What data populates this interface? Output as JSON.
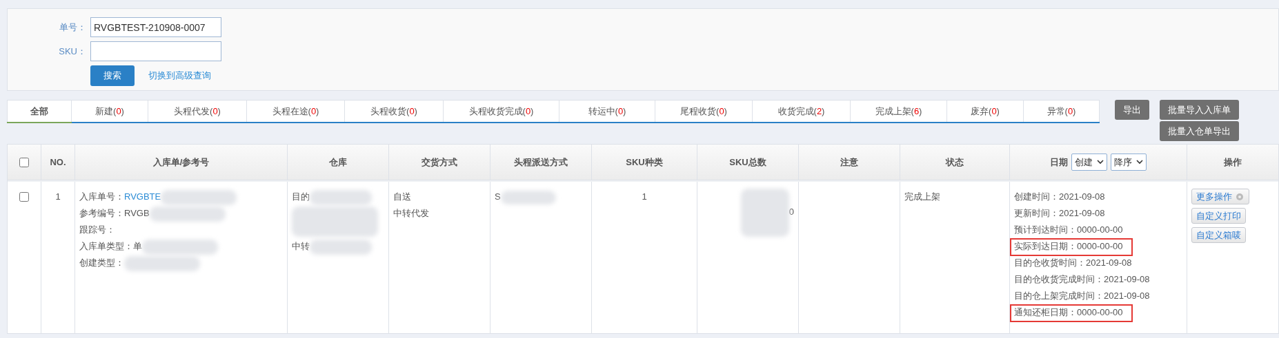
{
  "search": {
    "fields": [
      {
        "label": "单号：",
        "value": "RVGBTEST-210908-0007"
      },
      {
        "label": "SKU："
      }
    ],
    "button": "搜索",
    "link": "切换到高级查询"
  },
  "tabs": [
    {
      "label": "全部",
      "selected": true
    },
    {
      "label": "新建",
      "open": "(",
      "count": "0",
      "close": ")",
      "selected": false
    },
    {
      "label": "头程代发",
      "open": "(",
      "count": "0",
      "close": ")",
      "selected": false
    },
    {
      "label": "头程在途",
      "open": "(",
      "count": "0",
      "close": ")",
      "selected": false
    },
    {
      "label": "头程收货",
      "open": "(",
      "count": "0",
      "close": ")",
      "selected": false
    },
    {
      "label": "头程收货完成",
      "open": "(",
      "count": "0",
      "close": ")",
      "selected": false
    },
    {
      "label": "转运中",
      "open": "(",
      "count": "0",
      "close": ")",
      "selected": false
    },
    {
      "label": "尾程收货",
      "open": "(",
      "count": "0",
      "close": ")",
      "selected": false
    },
    {
      "label": "收货完成",
      "open": "(",
      "count": "2",
      "close": ")",
      "selected": false
    },
    {
      "label": "完成上架",
      "open": "(",
      "count": "6",
      "close": ")",
      "selected": false
    },
    {
      "label": "废弃",
      "open": "(",
      "count": "0",
      "close": ")",
      "selected": false
    },
    {
      "label": "异常",
      "open": "(",
      "count": "0",
      "close": ")",
      "selected": false
    }
  ],
  "actions": {
    "export": "导出",
    "stacked": [
      "批量导入入库单",
      "批量入仓单导出"
    ]
  },
  "table": {
    "header_checked": false,
    "columns": [
      "NO.",
      "入库单/参考号",
      "仓库",
      "交货方式",
      "头程派送方式",
      "SKU种类",
      "SKU总数",
      "注意",
      "状态"
    ],
    "date_column": {
      "label": "日期",
      "field": "创建",
      "order": "降序"
    },
    "actions_column": "操作",
    "rows": [
      {
        "checked": false,
        "no": "1",
        "order_lines": [
          {
            "label": "入库单号：",
            "value": "RVGBTE",
            "link": true,
            "redacted": true
          },
          {
            "label": "参考编号：",
            "value": "RVGB",
            "redacted": true
          },
          {
            "label": "跟踪号：",
            "redacted": false
          },
          {
            "label": "入库单类型：",
            "value": "单",
            "redacted": true
          },
          {
            "label": "创建类型：",
            "redacted": true
          }
        ],
        "warehouse": [
          {
            "kind": "text",
            "text": "目的",
            "redacted": true
          },
          {
            "kind": "blur"
          },
          {
            "kind": "text",
            "text": "中转",
            "redacted": true
          }
        ],
        "delivery": [
          "自送",
          "中转代发"
        ],
        "first_leg": {
          "text": "S",
          "redacted": true
        },
        "sku_kinds": "1",
        "sku_total": {
          "text": "0",
          "redacted": true
        },
        "status": "完成上架",
        "dates": [
          {
            "label": "创建时间：",
            "value": "2021-09-08",
            "highlighted": false
          },
          {
            "label": "更新时间：",
            "value": "2021-09-08",
            "highlighted": false
          },
          {
            "label": "预计到达时间：",
            "value": "0000-00-00",
            "highlighted": false
          },
          {
            "label": "实际到达日期：",
            "value": "0000-00-00",
            "highlighted": true
          },
          {
            "label": "目的仓收货时间：",
            "value": "2021-09-08",
            "highlighted": false
          },
          {
            "label": "目的仓收货完成时间：",
            "value": "2021-09-08",
            "highlighted": false
          },
          {
            "label": "目的仓上架完成时间：",
            "value": "2021-09-08",
            "highlighted": false
          },
          {
            "label": "通知还柜日期：",
            "value": "0000-00-00",
            "highlighted": true
          }
        ],
        "operations": [
          {
            "label": "更多操作",
            "kind": "menu"
          },
          {
            "label": "自定义打印",
            "kind": "plain"
          },
          {
            "label": "自定义箱唛",
            "kind": "plain"
          }
        ]
      }
    ]
  }
}
